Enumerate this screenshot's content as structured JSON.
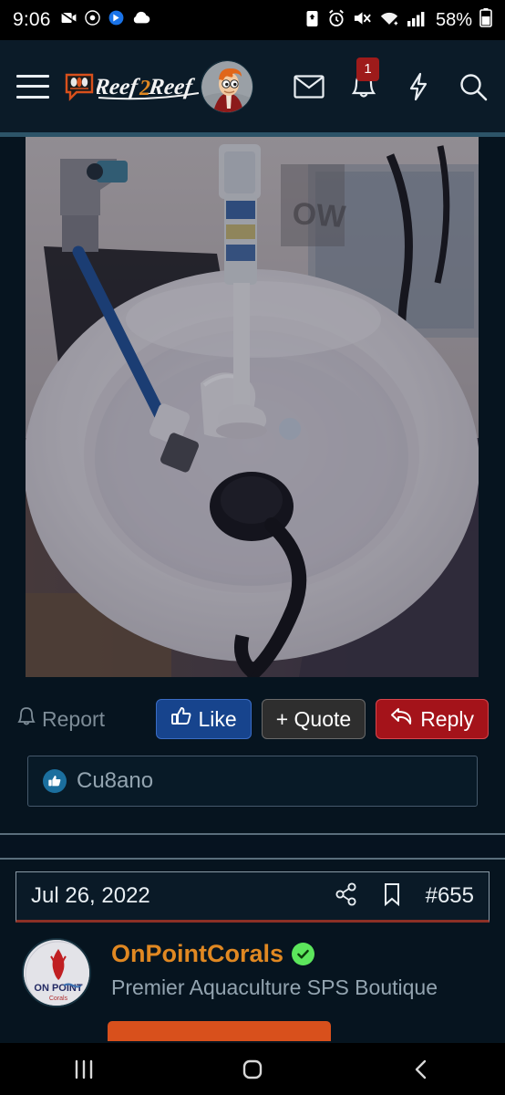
{
  "statusbar": {
    "time": "9:06",
    "battery_percent": "58%",
    "left_icons": [
      "screen-record-icon",
      "target-icon",
      "bixby-icon",
      "cloud-icon"
    ],
    "right_icons": [
      "battery-saver-icon",
      "alarm-icon",
      "mute-icon",
      "wifi-icon",
      "signal-icon",
      "battery-icon"
    ]
  },
  "header": {
    "menu_label": "menu",
    "brand": "Reef2Reef",
    "brand_accent_color": "#e08822",
    "avatar_alt": "user-avatar",
    "icons": [
      {
        "name": "inbox-icon",
        "badge": ""
      },
      {
        "name": "alerts-icon",
        "badge": "1"
      },
      {
        "name": "whats-new-icon",
        "badge": ""
      },
      {
        "name": "search-icon",
        "badge": ""
      }
    ],
    "alerts_badge": "1",
    "accent_underline_color": "#2d5468"
  },
  "post_image": {
    "alt": "white-cylindrical-sump-reservoir-with-dosing-tube-and-pump"
  },
  "actions": {
    "report_label": "Report",
    "like_label": "Like",
    "quote_label": "+ Quote",
    "reply_label": "Reply",
    "like_color": "#17448d",
    "quote_color": "#2e2e2e",
    "reply_color": "#a4131a"
  },
  "likes": {
    "users": "Cu8ano"
  },
  "next_post": {
    "date": "Jul 26, 2022",
    "post_number": "#655",
    "share_icon": "share-icon",
    "bookmark_icon": "bookmark-icon",
    "author_name": "OnPointCorals",
    "author_verified": true,
    "author_tagline": "Premier Aquaculture SPS Boutique",
    "author_name_color": "#e08822",
    "avatar_logo_line1": "ON  POINT",
    "avatar_logo_line2": "Corals"
  },
  "navbar": {
    "recents_label": "recents",
    "home_label": "home",
    "back_label": "back"
  }
}
